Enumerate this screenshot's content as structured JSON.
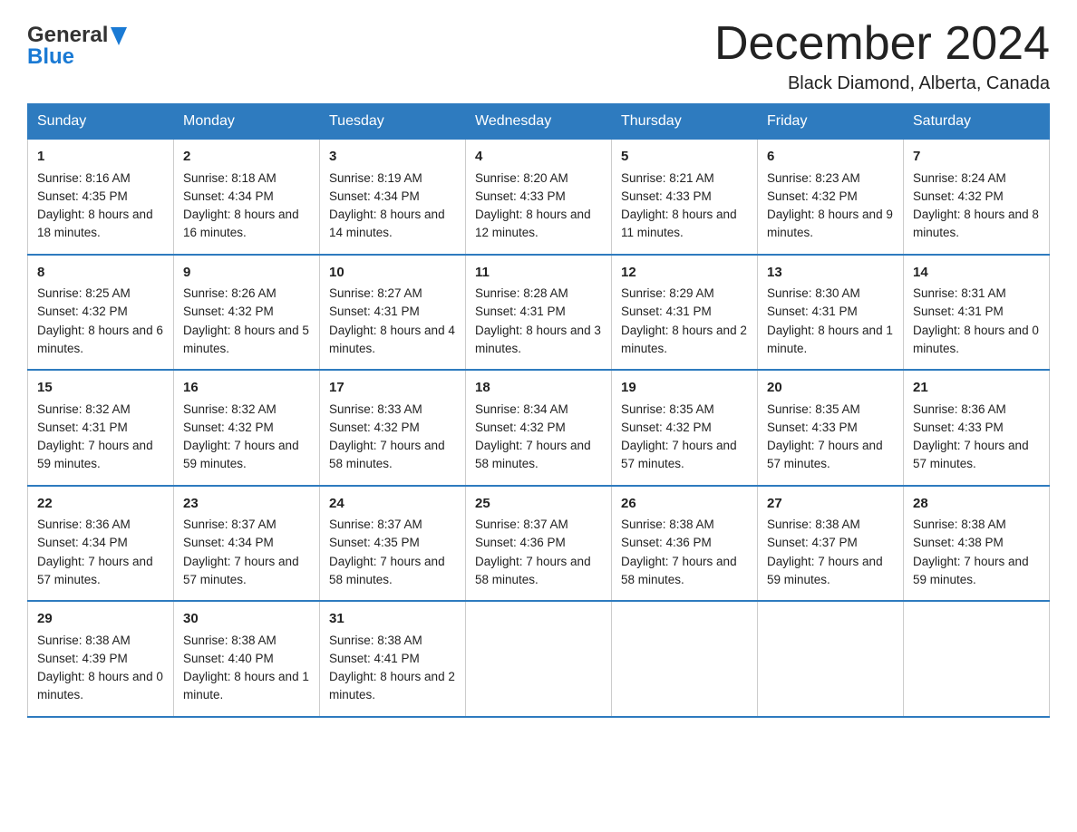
{
  "header": {
    "logo_general": "General",
    "logo_blue": "Blue",
    "month_title": "December 2024",
    "location": "Black Diamond, Alberta, Canada"
  },
  "days_header": [
    "Sunday",
    "Monday",
    "Tuesday",
    "Wednesday",
    "Thursday",
    "Friday",
    "Saturday"
  ],
  "weeks": [
    [
      {
        "day": "1",
        "sunrise": "8:16 AM",
        "sunset": "4:35 PM",
        "daylight": "8 hours and 18 minutes."
      },
      {
        "day": "2",
        "sunrise": "8:18 AM",
        "sunset": "4:34 PM",
        "daylight": "8 hours and 16 minutes."
      },
      {
        "day": "3",
        "sunrise": "8:19 AM",
        "sunset": "4:34 PM",
        "daylight": "8 hours and 14 minutes."
      },
      {
        "day": "4",
        "sunrise": "8:20 AM",
        "sunset": "4:33 PM",
        "daylight": "8 hours and 12 minutes."
      },
      {
        "day": "5",
        "sunrise": "8:21 AM",
        "sunset": "4:33 PM",
        "daylight": "8 hours and 11 minutes."
      },
      {
        "day": "6",
        "sunrise": "8:23 AM",
        "sunset": "4:32 PM",
        "daylight": "8 hours and 9 minutes."
      },
      {
        "day": "7",
        "sunrise": "8:24 AM",
        "sunset": "4:32 PM",
        "daylight": "8 hours and 8 minutes."
      }
    ],
    [
      {
        "day": "8",
        "sunrise": "8:25 AM",
        "sunset": "4:32 PM",
        "daylight": "8 hours and 6 minutes."
      },
      {
        "day": "9",
        "sunrise": "8:26 AM",
        "sunset": "4:32 PM",
        "daylight": "8 hours and 5 minutes."
      },
      {
        "day": "10",
        "sunrise": "8:27 AM",
        "sunset": "4:31 PM",
        "daylight": "8 hours and 4 minutes."
      },
      {
        "day": "11",
        "sunrise": "8:28 AM",
        "sunset": "4:31 PM",
        "daylight": "8 hours and 3 minutes."
      },
      {
        "day": "12",
        "sunrise": "8:29 AM",
        "sunset": "4:31 PM",
        "daylight": "8 hours and 2 minutes."
      },
      {
        "day": "13",
        "sunrise": "8:30 AM",
        "sunset": "4:31 PM",
        "daylight": "8 hours and 1 minute."
      },
      {
        "day": "14",
        "sunrise": "8:31 AM",
        "sunset": "4:31 PM",
        "daylight": "8 hours and 0 minutes."
      }
    ],
    [
      {
        "day": "15",
        "sunrise": "8:32 AM",
        "sunset": "4:31 PM",
        "daylight": "7 hours and 59 minutes."
      },
      {
        "day": "16",
        "sunrise": "8:32 AM",
        "sunset": "4:32 PM",
        "daylight": "7 hours and 59 minutes."
      },
      {
        "day": "17",
        "sunrise": "8:33 AM",
        "sunset": "4:32 PM",
        "daylight": "7 hours and 58 minutes."
      },
      {
        "day": "18",
        "sunrise": "8:34 AM",
        "sunset": "4:32 PM",
        "daylight": "7 hours and 58 minutes."
      },
      {
        "day": "19",
        "sunrise": "8:35 AM",
        "sunset": "4:32 PM",
        "daylight": "7 hours and 57 minutes."
      },
      {
        "day": "20",
        "sunrise": "8:35 AM",
        "sunset": "4:33 PM",
        "daylight": "7 hours and 57 minutes."
      },
      {
        "day": "21",
        "sunrise": "8:36 AM",
        "sunset": "4:33 PM",
        "daylight": "7 hours and 57 minutes."
      }
    ],
    [
      {
        "day": "22",
        "sunrise": "8:36 AM",
        "sunset": "4:34 PM",
        "daylight": "7 hours and 57 minutes."
      },
      {
        "day": "23",
        "sunrise": "8:37 AM",
        "sunset": "4:34 PM",
        "daylight": "7 hours and 57 minutes."
      },
      {
        "day": "24",
        "sunrise": "8:37 AM",
        "sunset": "4:35 PM",
        "daylight": "7 hours and 58 minutes."
      },
      {
        "day": "25",
        "sunrise": "8:37 AM",
        "sunset": "4:36 PM",
        "daylight": "7 hours and 58 minutes."
      },
      {
        "day": "26",
        "sunrise": "8:38 AM",
        "sunset": "4:36 PM",
        "daylight": "7 hours and 58 minutes."
      },
      {
        "day": "27",
        "sunrise": "8:38 AM",
        "sunset": "4:37 PM",
        "daylight": "7 hours and 59 minutes."
      },
      {
        "day": "28",
        "sunrise": "8:38 AM",
        "sunset": "4:38 PM",
        "daylight": "7 hours and 59 minutes."
      }
    ],
    [
      {
        "day": "29",
        "sunrise": "8:38 AM",
        "sunset": "4:39 PM",
        "daylight": "8 hours and 0 minutes."
      },
      {
        "day": "30",
        "sunrise": "8:38 AM",
        "sunset": "4:40 PM",
        "daylight": "8 hours and 1 minute."
      },
      {
        "day": "31",
        "sunrise": "8:38 AM",
        "sunset": "4:41 PM",
        "daylight": "8 hours and 2 minutes."
      },
      null,
      null,
      null,
      null
    ]
  ],
  "labels": {
    "sunrise": "Sunrise: ",
    "sunset": "Sunset: ",
    "daylight": "Daylight: "
  }
}
